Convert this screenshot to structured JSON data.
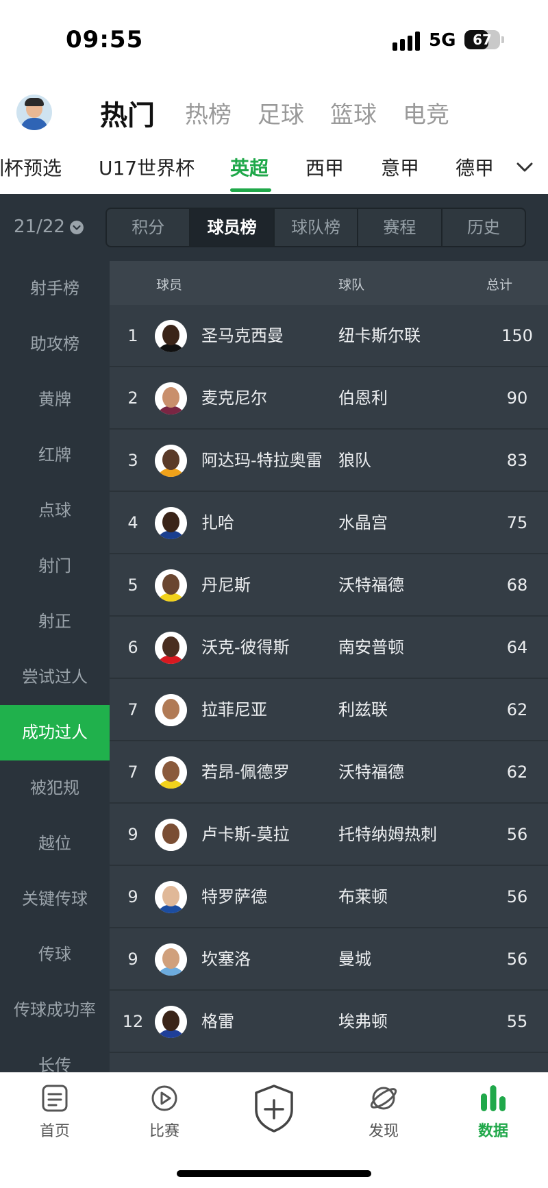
{
  "status_bar": {
    "time": "09:55",
    "network": "5G",
    "battery": "67",
    "battery_level": 0.67
  },
  "top_tabs": [
    {
      "label": "热门",
      "active": true
    },
    {
      "label": "热榜",
      "active": false
    },
    {
      "label": "足球",
      "active": false
    },
    {
      "label": "篮球",
      "active": false
    },
    {
      "label": "电竞",
      "active": false
    }
  ],
  "league_tabs": [
    {
      "label": "训杯预选",
      "active": false
    },
    {
      "label": "U17世界杯",
      "active": false
    },
    {
      "label": "英超",
      "active": true
    },
    {
      "label": "西甲",
      "active": false
    },
    {
      "label": "意甲",
      "active": false
    },
    {
      "label": "德甲",
      "active": false
    }
  ],
  "season": "21/22",
  "segments": [
    {
      "label": "积分",
      "active": false
    },
    {
      "label": "球员榜",
      "active": true
    },
    {
      "label": "球队榜",
      "active": false
    },
    {
      "label": "赛程",
      "active": false
    },
    {
      "label": "历史",
      "active": false
    }
  ],
  "sidebar": [
    {
      "label": "射手榜"
    },
    {
      "label": "助攻榜"
    },
    {
      "label": "黄牌"
    },
    {
      "label": "红牌"
    },
    {
      "label": "点球"
    },
    {
      "label": "射门"
    },
    {
      "label": "射正"
    },
    {
      "label": "尝试过人"
    },
    {
      "label": "成功过人",
      "active": true
    },
    {
      "label": "被犯规"
    },
    {
      "label": "越位"
    },
    {
      "label": "关键传球"
    },
    {
      "label": "传球"
    },
    {
      "label": "传球成功率"
    },
    {
      "label": "长传"
    }
  ],
  "table": {
    "headers": {
      "player": "球员",
      "team": "球队",
      "total": "总计"
    },
    "rows": [
      {
        "rank": "1",
        "name": "圣马克西曼",
        "team": "纽卡斯尔联",
        "total": "150",
        "skin": "#3a2418",
        "kit": "#111111"
      },
      {
        "rank": "2",
        "name": "麦克尼尔",
        "team": "伯恩利",
        "total": "90",
        "skin": "#c98f6c",
        "kit": "#7a2643"
      },
      {
        "rank": "3",
        "name": "阿达玛-特拉奥雷",
        "team": "狼队",
        "total": "83",
        "skin": "#5a3a28",
        "kit": "#f0a21a"
      },
      {
        "rank": "4",
        "name": "扎哈",
        "team": "水晶宫",
        "total": "75",
        "skin": "#3a2418",
        "kit": "#1b3f8f"
      },
      {
        "rank": "5",
        "name": "丹尼斯",
        "team": "沃特福德",
        "total": "68",
        "skin": "#6a4630",
        "kit": "#f2d21c"
      },
      {
        "rank": "6",
        "name": "沃克-彼得斯",
        "team": "南安普顿",
        "total": "64",
        "skin": "#4a2e20",
        "kit": "#d71920"
      },
      {
        "rank": "7",
        "name": "拉菲尼亚",
        "team": "利兹联",
        "total": "62",
        "skin": "#b07a55",
        "kit": "#ffffff"
      },
      {
        "rank": "7",
        "name": "若昂-佩德罗",
        "team": "沃特福德",
        "total": "62",
        "skin": "#8a5a3c",
        "kit": "#f2d21c"
      },
      {
        "rank": "9",
        "name": "卢卡斯-莫拉",
        "team": "托特纳姆热刺",
        "total": "56",
        "skin": "#7a4e34",
        "kit": "#ffffff"
      },
      {
        "rank": "9",
        "name": "特罗萨德",
        "team": "布莱顿",
        "total": "56",
        "skin": "#e0b898",
        "kit": "#1c4da1"
      },
      {
        "rank": "9",
        "name": "坎塞洛",
        "team": "曼城",
        "total": "56",
        "skin": "#d0a07c",
        "kit": "#6cabdd"
      },
      {
        "rank": "12",
        "name": "格雷",
        "team": "埃弗顿",
        "total": "55",
        "skin": "#3a2418",
        "kit": "#1f3f99"
      }
    ]
  },
  "bottom_nav": [
    {
      "label": "首页",
      "icon": "home-doc-icon"
    },
    {
      "label": "比赛",
      "icon": "play-circle-icon"
    },
    {
      "label": "",
      "icon": "add-shield-icon"
    },
    {
      "label": "发现",
      "icon": "planet-icon"
    },
    {
      "label": "数据",
      "icon": "bar-chart-icon",
      "active": true
    }
  ],
  "colors": {
    "accent": "#20a84a",
    "panel": "#2a333b",
    "table": "#343d45"
  }
}
